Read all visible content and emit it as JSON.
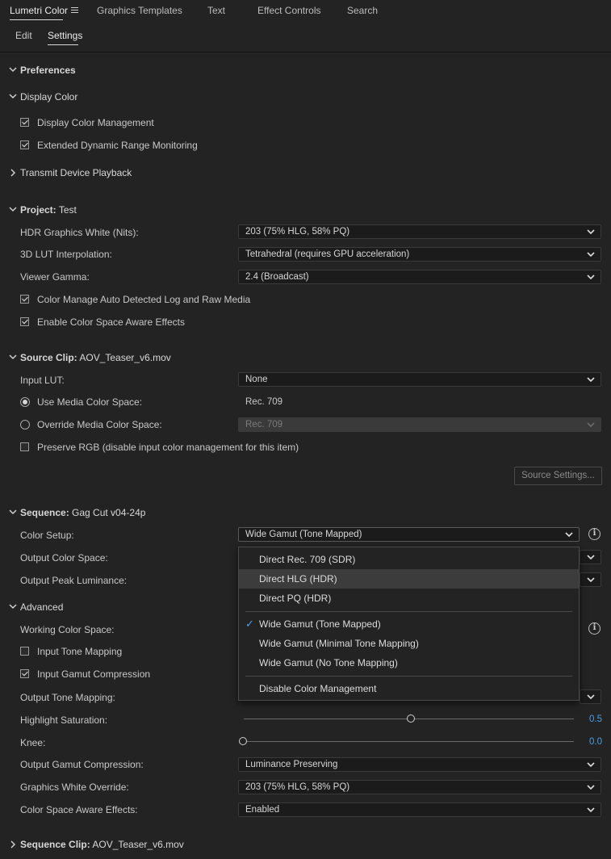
{
  "tabs": {
    "lumetri": "Lumetri Color",
    "graphics": "Graphics Templates",
    "text": "Text",
    "effect_controls": "Effect Controls",
    "search": "Search"
  },
  "subtabs": {
    "edit": "Edit",
    "settings": "Settings"
  },
  "preferences": {
    "title": "Preferences"
  },
  "display_color": {
    "title": "Display Color",
    "display_color_management": "Display Color Management",
    "edr_monitoring": "Extended Dynamic Range Monitoring",
    "transmit": "Transmit Device Playback"
  },
  "project": {
    "title": "Project:",
    "name": "Test",
    "hdr_white_label": "HDR Graphics White (Nits):",
    "hdr_white_value": "203 (75% HLG, 58% PQ)",
    "lut_interp_label": "3D LUT Interpolation:",
    "lut_interp_value": "Tetrahedral (requires GPU acceleration)",
    "viewer_gamma_label": "Viewer Gamma:",
    "viewer_gamma_value": "2.4 (Broadcast)",
    "auto_log_raw": "Color Manage Auto Detected Log and Raw Media",
    "space_aware": "Enable Color Space Aware Effects"
  },
  "source_clip": {
    "title": "Source Clip:",
    "name": "AOV_Teaser_v6.mov",
    "input_lut_label": "Input LUT:",
    "input_lut_value": "None",
    "use_media_label": "Use Media Color Space:",
    "use_media_value": "Rec. 709",
    "override_label": "Override Media Color Space:",
    "override_value": "Rec. 709",
    "preserve_rgb": "Preserve RGB (disable input color management for this item)",
    "source_settings_button": "Source Settings..."
  },
  "sequence": {
    "title": "Sequence:",
    "name": "Gag Cut v04-24p",
    "color_setup_label": "Color Setup:",
    "color_setup_value": "Wide Gamut (Tone Mapped)",
    "output_cs_label": "Output Color Space:",
    "output_peak_label": "Output Peak Luminance:",
    "advanced_title": "Advanced",
    "working_cs_label": "Working Color Space:",
    "input_tone_mapping": "Input Tone Mapping",
    "input_gamut_compression": "Input Gamut Compression",
    "output_tone_mapping_label": "Output Tone Mapping:",
    "highlight_sat_label": "Highlight Saturation:",
    "highlight_sat_value": "0.5",
    "knee_label": "Knee:",
    "knee_value": "0.0",
    "output_gamut_label": "Output Gamut Compression:",
    "output_gamut_value": "Luminance Preserving",
    "graphics_white_label": "Graphics White Override:",
    "graphics_white_value": "203 (75% HLG, 58% PQ)",
    "space_aware_label": "Color Space Aware Effects:",
    "space_aware_value": "Enabled"
  },
  "sequence_clip": {
    "title": "Sequence Clip:",
    "name": "AOV_Teaser_v6.mov"
  },
  "menu": {
    "items": [
      "Direct Rec. 709 (SDR)",
      "Direct HLG (HDR)",
      "Direct PQ (HDR)",
      "Wide Gamut (Tone Mapped)",
      "Wide Gamut (Minimal Tone Mapping)",
      "Wide Gamut (No Tone Mapping)",
      "Disable Color Management"
    ],
    "checkmark": "✓"
  },
  "icons": {
    "info": "i"
  },
  "colors": {
    "accent": "#4a9ee6",
    "background": "#232323"
  }
}
